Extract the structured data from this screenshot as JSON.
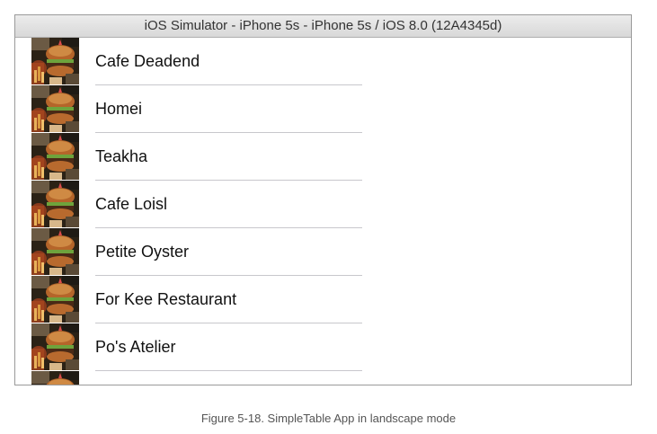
{
  "window": {
    "title": "iOS Simulator - iPhone 5s - iPhone 5s / iOS 8.0 (12A4345d)"
  },
  "table": {
    "rows": [
      {
        "name": "Cafe Deadend",
        "thumbnail": "burger-photo"
      },
      {
        "name": "Homei",
        "thumbnail": "burger-photo"
      },
      {
        "name": "Teakha",
        "thumbnail": "burger-photo"
      },
      {
        "name": "Cafe Loisl",
        "thumbnail": "burger-photo"
      },
      {
        "name": "Petite Oyster",
        "thumbnail": "burger-photo"
      },
      {
        "name": "For Kee Restaurant",
        "thumbnail": "burger-photo"
      },
      {
        "name": "Po's Atelier",
        "thumbnail": "burger-photo"
      },
      {
        "name": "",
        "thumbnail": "burger-photo"
      }
    ]
  },
  "caption": "Figure 5-18. SimpleTable App in landscape mode",
  "colors": {
    "separator": "#c8c7cc",
    "title_bar": "#e2e2e2",
    "text": "#111111"
  }
}
